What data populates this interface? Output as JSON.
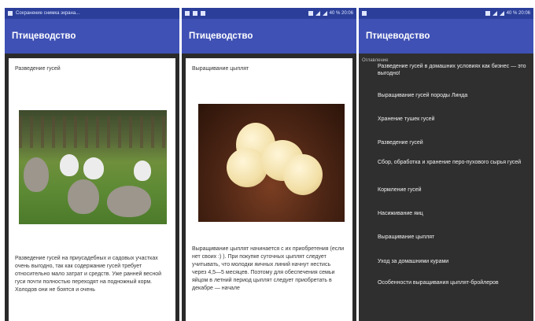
{
  "screen1": {
    "statusbar_text": "Сохранение снимка экрана...",
    "title": "Птицеводство",
    "card_title": "Разведение гусей",
    "card_text": "Разведение гусей на приусадебных и садовых участках очень выгодно, так как содержание гусей требует относительно мало затрат и средств. Уже ранней весной гуси почти полностью переходят на подножный корм. Холодов они не боятся и очень"
  },
  "screen2": {
    "statusbar_time": "40 % 20:06",
    "title": "Птицеводство",
    "card_title": "Выращивание цыплят",
    "card_text": "Выращивание цыплят начинается с их приобретения (если нет своих :) ). При покупке суточных цыплят следует учитывать, что молодки яичных линий начнут нестись через 4,5—5 месяцев. Поэтому для обеспечения семьи яйцом в летний период цыплят следует приобретать в декабре — начале"
  },
  "screen3": {
    "statusbar_time": "40 % 20:06",
    "title": "Птицеводство",
    "section_label": "Оглавление",
    "menu_items": [
      "Разведение гусей в домашних условиях как бизнес — это выгодно!",
      "Выращивание гусей породы Линда",
      "Хранение тушек гусей",
      "Разведение гусей",
      "Сбор, обработка и хранение перо-пухового сырья гусей",
      "Кормление гусей",
      "Насиживание яиц",
      "Выращивание цыплят",
      "Уход за домашними курами",
      "Особенности выращивания цыплят-бройлеров"
    ]
  }
}
